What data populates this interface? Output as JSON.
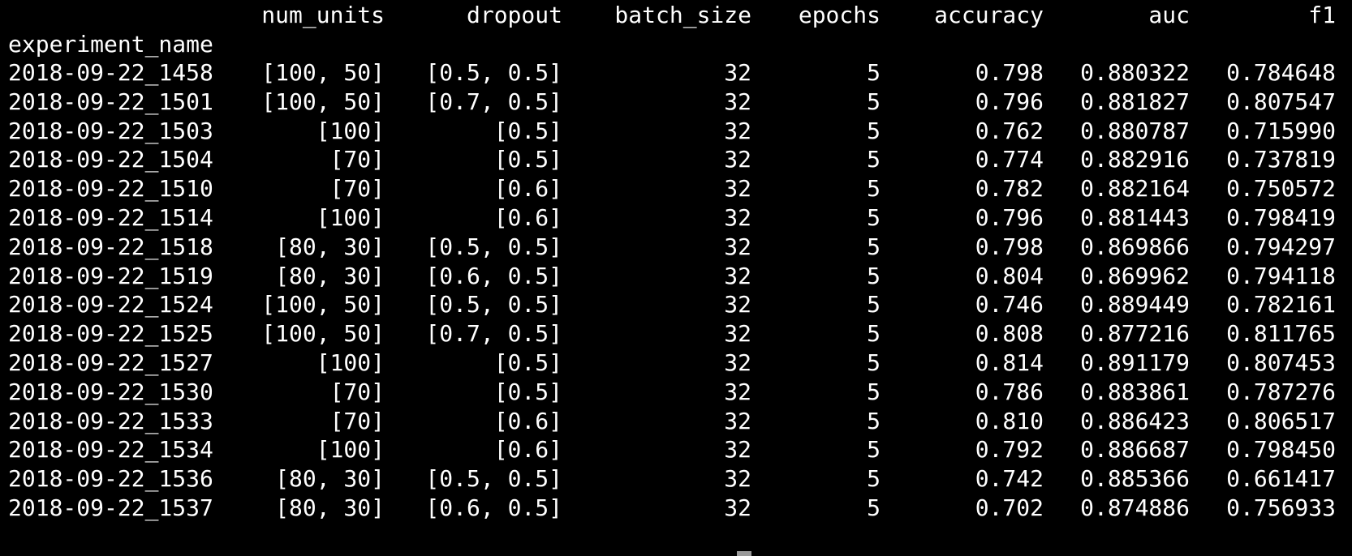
{
  "header": {
    "columns": [
      "num_units",
      "dropout",
      "batch_size",
      "epochs",
      "accuracy",
      "auc",
      "f1"
    ],
    "index_name": "experiment_name"
  },
  "rows": [
    [
      "2018-09-22_1458",
      "[100, 50]",
      "[0.5, 0.5]",
      "32",
      "5",
      "0.798",
      "0.880322",
      "0.784648"
    ],
    [
      "2018-09-22_1501",
      "[100, 50]",
      "[0.7, 0.5]",
      "32",
      "5",
      "0.796",
      "0.881827",
      "0.807547"
    ],
    [
      "2018-09-22_1503",
      "[100]",
      "[0.5]",
      "32",
      "5",
      "0.762",
      "0.880787",
      "0.715990"
    ],
    [
      "2018-09-22_1504",
      "[70]",
      "[0.5]",
      "32",
      "5",
      "0.774",
      "0.882916",
      "0.737819"
    ],
    [
      "2018-09-22_1510",
      "[70]",
      "[0.6]",
      "32",
      "5",
      "0.782",
      "0.882164",
      "0.750572"
    ],
    [
      "2018-09-22_1514",
      "[100]",
      "[0.6]",
      "32",
      "5",
      "0.796",
      "0.881443",
      "0.798419"
    ],
    [
      "2018-09-22_1518",
      "[80, 30]",
      "[0.5, 0.5]",
      "32",
      "5",
      "0.798",
      "0.869866",
      "0.794297"
    ],
    [
      "2018-09-22_1519",
      "[80, 30]",
      "[0.6, 0.5]",
      "32",
      "5",
      "0.804",
      "0.869962",
      "0.794118"
    ],
    [
      "2018-09-22_1524",
      "[100, 50]",
      "[0.5, 0.5]",
      "32",
      "5",
      "0.746",
      "0.889449",
      "0.782161"
    ],
    [
      "2018-09-22_1525",
      "[100, 50]",
      "[0.7, 0.5]",
      "32",
      "5",
      "0.808",
      "0.877216",
      "0.811765"
    ],
    [
      "2018-09-22_1527",
      "[100]",
      "[0.5]",
      "32",
      "5",
      "0.814",
      "0.891179",
      "0.807453"
    ],
    [
      "2018-09-22_1530",
      "[70]",
      "[0.5]",
      "32",
      "5",
      "0.786",
      "0.883861",
      "0.787276"
    ],
    [
      "2018-09-22_1533",
      "[70]",
      "[0.6]",
      "32",
      "5",
      "0.810",
      "0.886423",
      "0.806517"
    ],
    [
      "2018-09-22_1534",
      "[100]",
      "[0.6]",
      "32",
      "5",
      "0.792",
      "0.886687",
      "0.798450"
    ],
    [
      "2018-09-22_1536",
      "[80, 30]",
      "[0.5, 0.5]",
      "32",
      "5",
      "0.742",
      "0.885366",
      "0.661417"
    ],
    [
      "2018-09-22_1537",
      "[80, 30]",
      "[0.6, 0.5]",
      "32",
      "5",
      "0.702",
      "0.874886",
      "0.756933"
    ]
  ],
  "colors": {
    "background": "#000000",
    "text": "#ffffff",
    "cursor": "#9a9a9a"
  }
}
